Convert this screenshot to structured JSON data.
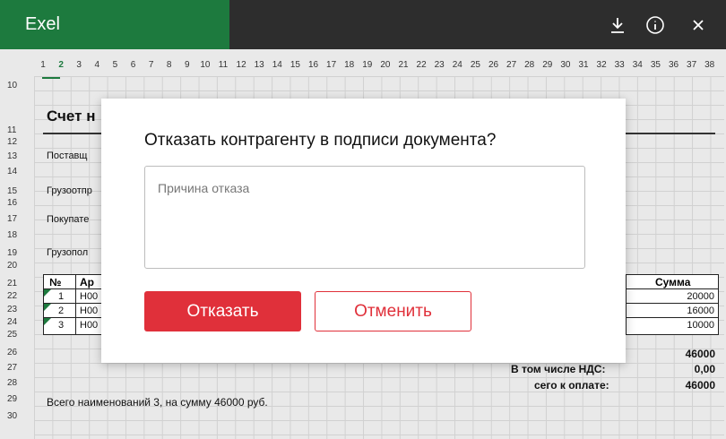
{
  "app": {
    "title": "Exel"
  },
  "toolbar": {
    "download_icon": "download-icon",
    "info_icon": "info-icon",
    "close_icon": "close-icon"
  },
  "sheet": {
    "columns": [
      "1",
      "2",
      "3",
      "4",
      "5",
      "6",
      "7",
      "8",
      "9",
      "10",
      "11",
      "12",
      "13",
      "14",
      "15",
      "16",
      "17",
      "18",
      "19",
      "20",
      "21",
      "22",
      "23",
      "24",
      "25",
      "26",
      "27",
      "28",
      "29",
      "30",
      "31",
      "32",
      "33",
      "34",
      "35",
      "36",
      "37",
      "38"
    ],
    "selected_column": "2",
    "rows": [
      "10",
      "11",
      "12",
      "13",
      "14",
      "15",
      "16",
      "17",
      "18",
      "19",
      "20",
      "21",
      "22",
      "23",
      "24",
      "25",
      "26",
      "27",
      "28",
      "29",
      "30"
    ],
    "title": "Счет н",
    "labels": {
      "supplier": "Поставщ",
      "shipper": "Грузоотпр",
      "buyer": "Покупате",
      "consignee": "Грузопол"
    },
    "table": {
      "header_no": "№",
      "header_art": "Ар",
      "header_sum": "Сумма",
      "rows": [
        {
          "no": "1",
          "art": "Н00",
          "sum": "20000"
        },
        {
          "no": "2",
          "art": "Н00",
          "sum": "16000"
        },
        {
          "no": "3",
          "art": "Н00",
          "sum": "10000"
        }
      ]
    },
    "totals": {
      "total_value": "46000",
      "vat_label": "В том числе НДС:",
      "vat_value": "0,00",
      "to_pay_label": "сего к оплате:",
      "to_pay_value": "46000"
    },
    "footer": "Всего наименований 3, на сумму 46000 руб."
  },
  "dialog": {
    "title": "Отказать контрагенту в подписи документа?",
    "reason_placeholder": "Причина отказа",
    "reason_value": "",
    "confirm_label": "Отказать",
    "cancel_label": "Отменить"
  },
  "colors": {
    "brand": "#1d7a3e",
    "accent": "#e0303a",
    "topbar": "#2d2d2d"
  }
}
